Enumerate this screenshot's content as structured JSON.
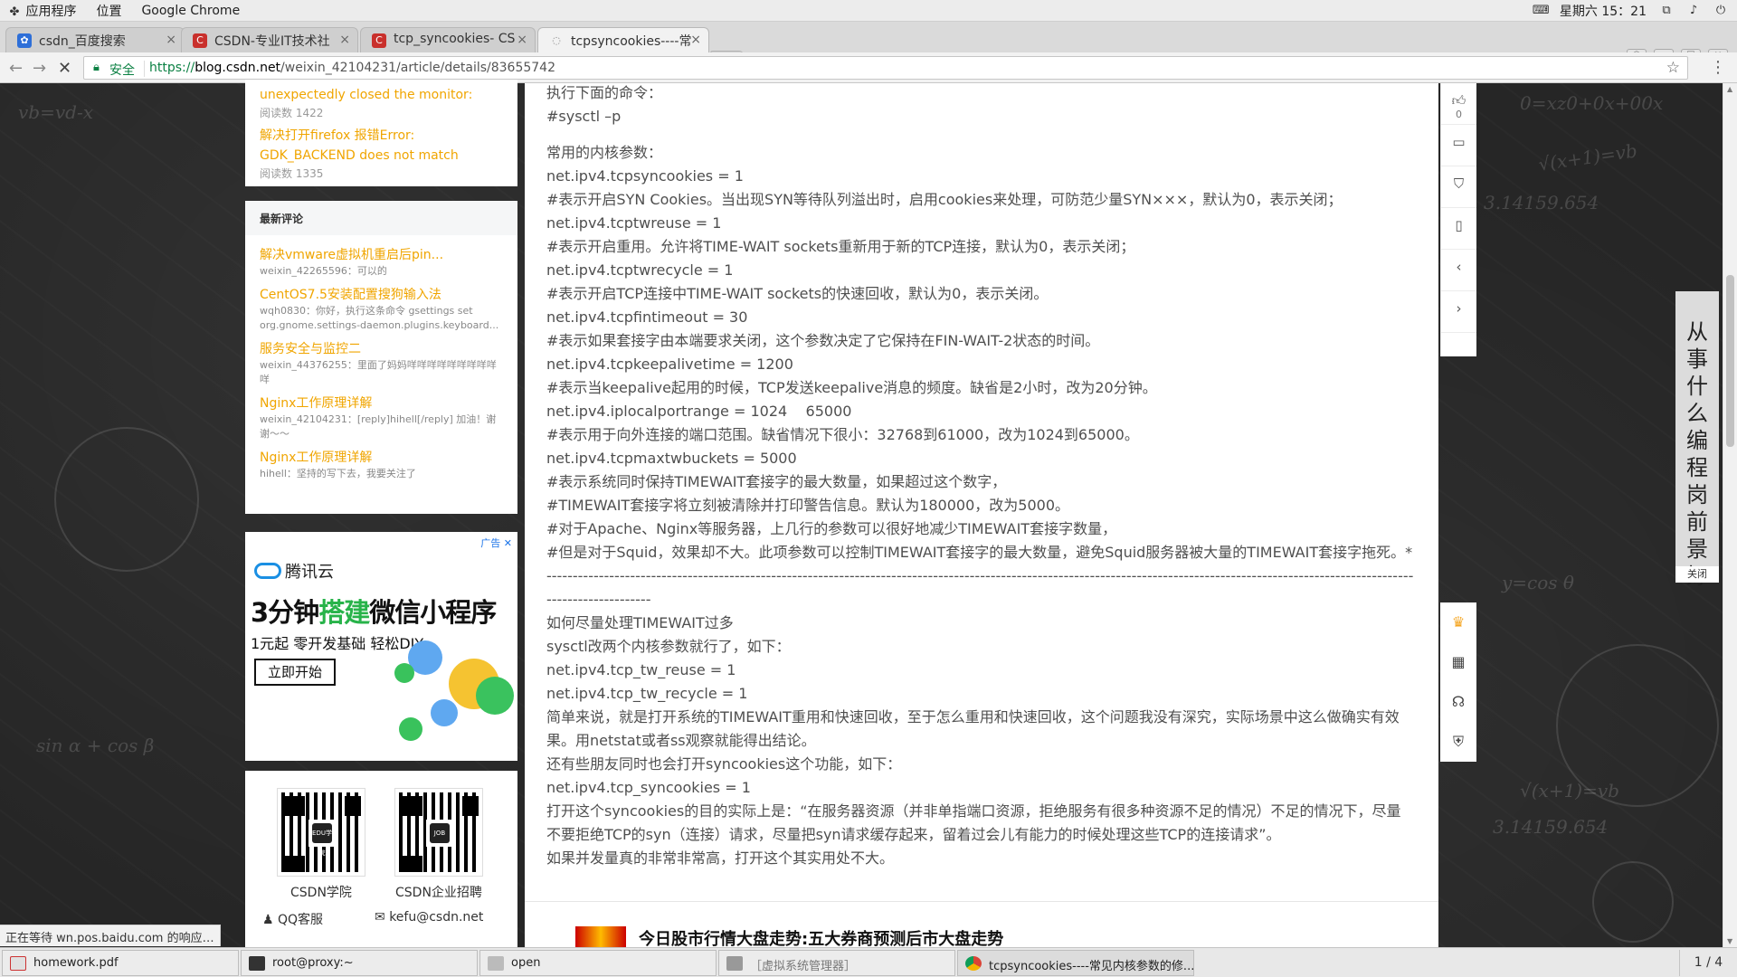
{
  "topbar": {
    "apps": "应用程序",
    "places": "位置",
    "app_name": "Google Chrome",
    "clock": "星期六 15：21"
  },
  "tabs": [
    {
      "title": "csdn_百度搜索",
      "favicon": "baidu-paw-icon"
    },
    {
      "title": "CSDN-专业IT技术社",
      "favicon": "csdn-c-icon"
    },
    {
      "title": "tcp_syncookies- CS",
      "favicon": "csdn-c-icon"
    },
    {
      "title": "tcpsyncookies----常",
      "favicon": "loading-spinner-icon"
    }
  ],
  "address": {
    "secure_label": "安全",
    "scheme": "https://",
    "host": "blog.csdn.net",
    "path": "/weixin_42104231/article/details/83655742"
  },
  "sidebar": {
    "popular": [
      {
        "title": "unexpectedly closed the monitor:",
        "views": "阅读数 1422"
      },
      {
        "title": "解决打开firefox 报错Error: GDK_BACKEND does not match",
        "views": "阅读数 1335"
      }
    ],
    "comments_header": "最新评论",
    "comments": [
      {
        "title": "解决vmware虚拟机重启后pin...",
        "text": "weixin_42265596：可以的"
      },
      {
        "title": "CentOS7.5安装配置搜狗输入法",
        "text": "wqh0830：你好，执行这条命令 gsettings set org.gnome.settings-daemon.plugins.keyboard..."
      },
      {
        "title": "服务安全与监控二",
        "text": "weixin_44376255：里面了妈妈咩咩咩咩咩咩咩咩咩咩"
      },
      {
        "title": "Nginx工作原理详解",
        "text": "weixin_42104231：[reply]hihell[/reply] 加油！谢谢～～"
      },
      {
        "title": "Nginx工作原理详解",
        "text": "hihell：坚持的写下去，我要关注了"
      }
    ],
    "ad": {
      "tag": "广告",
      "brand": "腾讯云",
      "headline_a": "3分钟",
      "headline_b": "搭建",
      "headline_c": "微信小程序",
      "sub": "1元起 零开发基础 轻松DIY",
      "cta": "立即开始"
    },
    "qr": [
      {
        "label": "CSDN学院",
        "badge": "EDU学院"
      },
      {
        "label": "CSDN企业招聘",
        "badge": "JOB"
      }
    ],
    "contact_qq": "QQ客服",
    "contact_mail": "kefu@csdn.net"
  },
  "article": {
    "lines": [
      "执行下面的命令：",
      "#sysctl –p",
      "",
      "常用的内核参数：",
      "net.ipv4.tcpsyncookies = 1",
      "#表示开启SYN Cookies。当出现SYN等待队列溢出时，启用cookies来处理，可防范少量SYN×××，默认为0，表示关闭；",
      "net.ipv4.tcptwreuse = 1",
      "#表示开启重用。允许将TIME-WAIT sockets重新用于新的TCP连接，默认为0，表示关闭；",
      "net.ipv4.tcptwrecycle = 1",
      "#表示开启TCP连接中TIME-WAIT sockets的快速回收，默认为0，表示关闭。",
      "net.ipv4.tcpfintimeout = 30",
      "#表示如果套接字由本端要求关闭，这个参数决定了它保持在FIN-WAIT-2状态的时间。",
      "net.ipv4.tcpkeepalivetime = 1200",
      "#表示当keepalive起用的时候，TCP发送keepalive消息的频度。缺省是2小时，改为20分钟。",
      "net.ipv4.iplocalportrange = 1024    65000",
      "#表示用于向外连接的端口范围。缺省情况下很小：32768到61000，改为1024到65000。",
      "net.ipv4.tcpmaxtwbuckets = 5000",
      "#表示系统同时保持TIMEWAIT套接字的最大数量，如果超过这个数字，",
      "#TIMEWAIT套接字将立刻被清除并打印警告信息。默认为180000，改为5000。",
      "#对于Apache、Nginx等服务器，上几行的参数可以很好地减少TIMEWAIT套接字数量，",
      "#但是对于Squid，效果却不大。此项参数可以控制TIMEWAIT套接字的最大数量，避免Squid服务器被大量的TIMEWAIT套接字拖死。*",
      "----------------------------------------------------------------------------------------------------------------------------------------------------------------------",
      "--------------------",
      "如何尽量处理TIMEWAIT过多",
      "sysctl改两个内核参数就行了，如下：",
      "net.ipv4.tcp_tw_reuse = 1",
      "net.ipv4.tcp_tw_recycle = 1",
      "简单来说，就是打开系统的TIMEWAIT重用和快速回收，至于怎么重用和快速回收，这个问题我没有深究，实际场景中这么做确实有效",
      "果。用netstat或者ss观察就能得出结论。",
      "还有些朋友同时也会打开syncookies这个功能，如下：",
      "net.ipv4.tcp_syncookies = 1",
      "打开这个syncookies的目的实际上是：“在服务器资源（并非单指端口资源，拒绝服务有很多种资源不足的情况）不足的情况下，尽量",
      "不要拒绝TCP的syn（连接）请求，尽量把syn请求缓存起来，留着过会儿有能力的时候处理这些TCP的连接请求”。",
      "如果并发量真的非常非常高，打开这个其实用处不大。"
    ],
    "news_title": "今日股市行情大盘走势:五大券商预测后市大盘走势"
  },
  "right_tools": {
    "like_count": "0"
  },
  "vertical_ad": {
    "text": "从事什么编程岗前景好",
    "close": "关闭"
  },
  "status_text": "正在等待 wn.pos.baidu.com 的响应…",
  "taskbar": {
    "items": [
      {
        "label": "homework.pdf"
      },
      {
        "label": "root@proxy:~"
      },
      {
        "label": "open"
      },
      {
        "label": "［虚拟系统管理器］"
      },
      {
        "label": "tcpsyncookies----常见内核参数的修..."
      }
    ],
    "pager": "1 / 4"
  },
  "colors": {
    "link_orange": "#f0a500",
    "secure_green": "#0b8043",
    "text_gray": "#4f4f4f"
  }
}
